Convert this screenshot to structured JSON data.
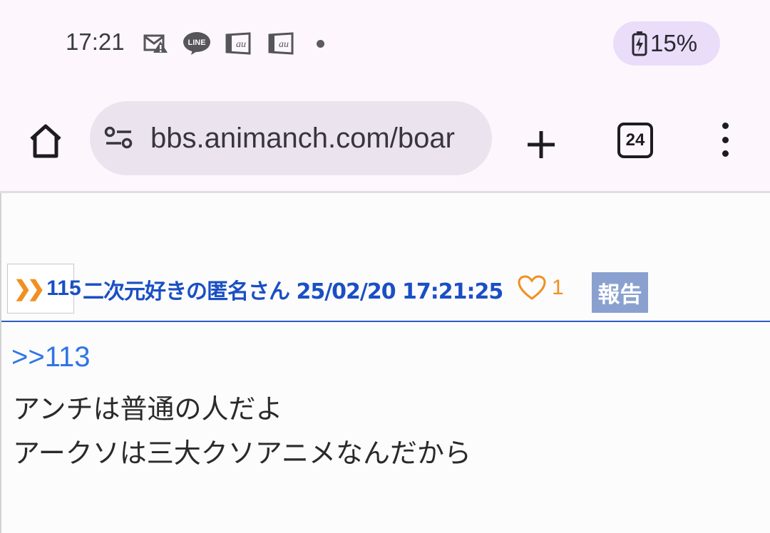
{
  "status_bar": {
    "time": "17:21",
    "icons": [
      "no-sim-warning-icon",
      "line-app-icon",
      "au-app-icon",
      "au-app-icon",
      "more-notifications-dot"
    ],
    "battery_percent": "15%",
    "battery_level": 0.15
  },
  "browser": {
    "url": "bbs.animanch.com/boar",
    "tab_count": "24"
  },
  "post": {
    "number": "115",
    "author": "二次元好きの匿名さん",
    "timestamp": "25/02/20 17:21:25",
    "like_count": "1",
    "report_label": "報告",
    "reply_ref": ">>113",
    "lines": [
      "アンチは普通の人だよ",
      "アークソは三大クソアニメなんだから"
    ]
  },
  "colors": {
    "accent_blue": "#1a4fc4",
    "link_blue": "#2f75e6",
    "orange": "#f09021",
    "report_bg": "#8aa1d0",
    "battery_pill": "#e9ddfa"
  }
}
